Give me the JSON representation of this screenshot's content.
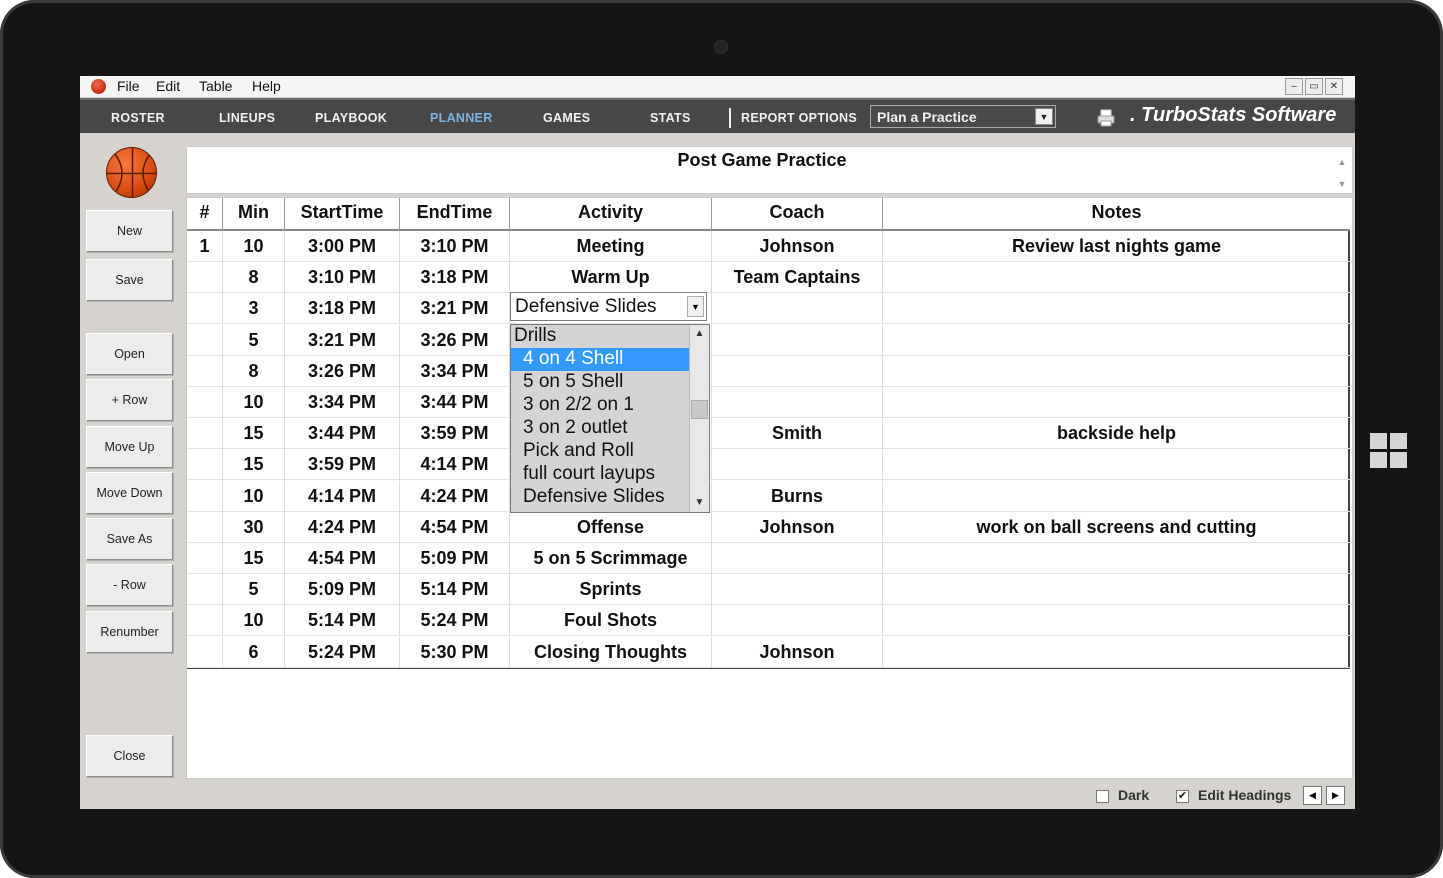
{
  "menu": [
    "File",
    "Edit",
    "Table",
    "Help"
  ],
  "window_controls": [
    "–",
    "▭",
    "✕"
  ],
  "nav": {
    "tabs": [
      "ROSTER",
      "LINEUPS",
      "PLAYBOOK",
      "PLANNER",
      "GAMES",
      "STATS"
    ],
    "report_options": "REPORT OPTIONS",
    "report_select": "Plan a Practice",
    "brand": "TurboStats Software",
    "brand_prefix": "."
  },
  "side_buttons": [
    "New",
    "Save",
    "Open",
    "+ Row",
    "Move Up",
    "Move Down",
    "Save As",
    "- Row",
    "Renumber",
    "Close"
  ],
  "practice_title": "Post Game Practice",
  "table": {
    "columns": [
      "#",
      "Min",
      "StartTime",
      "EndTime",
      "Activity",
      "Coach",
      "Notes"
    ],
    "rows": [
      [
        "1",
        "10",
        "3:00 PM",
        "3:10 PM",
        "Meeting",
        "Johnson",
        "Review last nights game"
      ],
      [
        "",
        "8",
        "3:10 PM",
        "3:18 PM",
        "Warm Up",
        "Team Captains",
        ""
      ],
      [
        "",
        "3",
        "3:18 PM",
        "3:21 PM",
        "",
        "",
        ""
      ],
      [
        "",
        "5",
        "3:21 PM",
        "3:26 PM",
        "",
        "",
        ""
      ],
      [
        "",
        "8",
        "3:26 PM",
        "3:34 PM",
        "",
        "",
        ""
      ],
      [
        "",
        "10",
        "3:34 PM",
        "3:44 PM",
        "",
        "",
        ""
      ],
      [
        "",
        "15",
        "3:44 PM",
        "3:59 PM",
        "",
        "Smith",
        "backside help"
      ],
      [
        "",
        "15",
        "3:59 PM",
        "4:14 PM",
        "",
        "",
        ""
      ],
      [
        "",
        "10",
        "4:14 PM",
        "4:24 PM",
        "",
        "Burns",
        ""
      ],
      [
        "",
        "30",
        "4:24 PM",
        "4:54 PM",
        "Offense",
        "Johnson",
        "work on ball screens and cutting"
      ],
      [
        "",
        "15",
        "4:54 PM",
        "5:09 PM",
        "5 on 5 Scrimmage",
        "",
        ""
      ],
      [
        "",
        "5",
        "5:09 PM",
        "5:14 PM",
        "Sprints",
        "",
        ""
      ],
      [
        "",
        "10",
        "5:14 PM",
        "5:24 PM",
        "Foul Shots",
        "",
        ""
      ],
      [
        "",
        "6",
        "5:24 PM",
        "5:30 PM",
        "Closing Thoughts",
        "Johnson",
        ""
      ]
    ]
  },
  "activity_combo": {
    "value": "Defensive Slides",
    "options": [
      "Drills",
      "4 on 4 Shell",
      "5 on 5 Shell",
      "3 on 2/2 on 1",
      "3 on 2 outlet",
      "Pick and Roll",
      "full court layups",
      "Defensive Slides"
    ],
    "highlighted": "4 on 4 Shell"
  },
  "footer": {
    "dark_label": "Dark",
    "dark_checked": false,
    "edit_headings_label": "Edit Headings",
    "edit_headings_checked": true,
    "checkmark": "✔"
  },
  "icons": [
    "app-ball-icon",
    "printer-icon",
    "basketball-icon",
    "windows-logo-icon",
    "dropdown-arrow-icon",
    "scroll-up-icon",
    "scroll-down-icon"
  ],
  "colors": {
    "nav_bg": "#474747",
    "active_tab": "#7ab3e0",
    "selection": "#3399ff",
    "panel_bg": "#d6d3ce"
  }
}
